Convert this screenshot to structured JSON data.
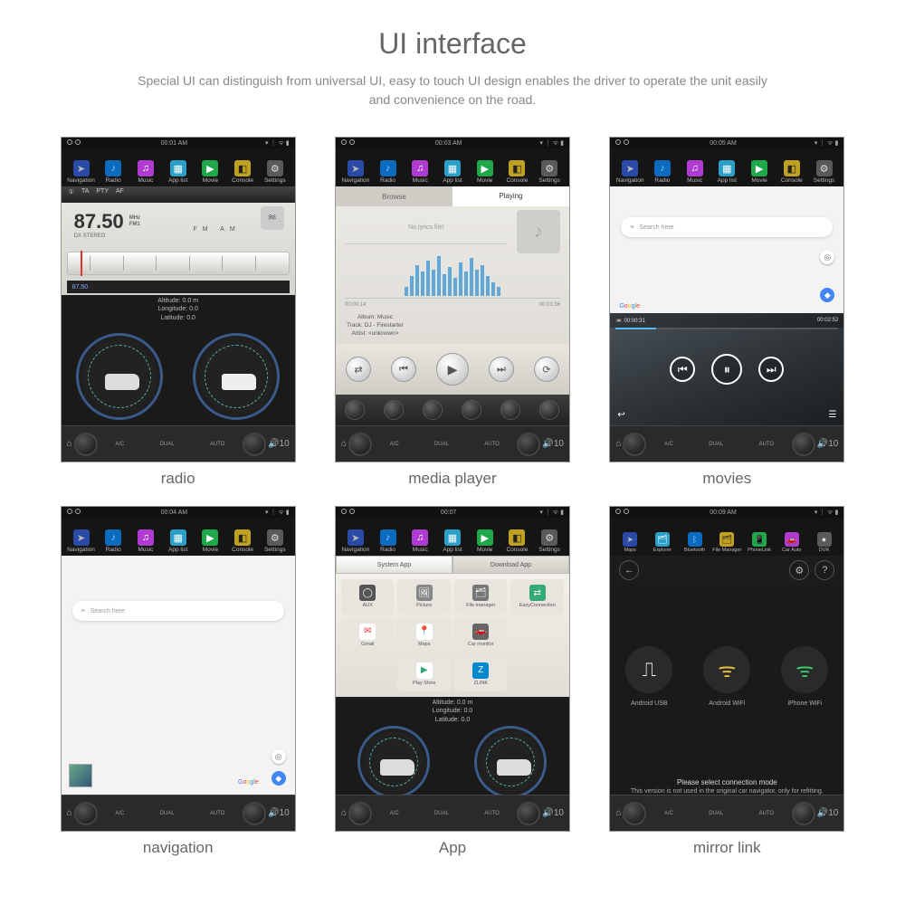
{
  "page": {
    "title": "UI interface",
    "subtitle": "Special UI can distinguish from universal UI, easy to touch UI design enables the driver to operate the unit easily and convenience on the road."
  },
  "captions": [
    "radio",
    "media player",
    "movies",
    "navigation",
    "App",
    "mirror link"
  ],
  "appbar": {
    "items": [
      "Navigation",
      "Radio",
      "Music",
      "App list",
      "Movie",
      "Console",
      "Settings"
    ],
    "items7": [
      "Maps",
      "Explorer",
      "Bluetooth",
      "File Manager",
      "PhoneLink",
      "Car Auto",
      "DVR"
    ]
  },
  "status": {
    "radio": "00:01 AM",
    "media": "00:03 AM",
    "movies": "00:05 AM",
    "nav": "00:04 AM",
    "app": "00:07",
    "mirror": "00:09 AM"
  },
  "radio": {
    "buttons": [
      "TA",
      "PTY",
      "AF"
    ],
    "ind": "①",
    "freq": "87.50",
    "unit": "MHz",
    "band": "FM1",
    "stereo": "DX  STEREO",
    "bands": "FM     AM",
    "preset": "87.50",
    "gps": {
      "alt": "Altitude:  0.0  m",
      "lon": "Longitude:  0.0",
      "lat": "Latitude:  0.0"
    }
  },
  "media": {
    "tabs": [
      "Browse",
      "Playing"
    ],
    "no_lyrics": "No lyrics file!",
    "t0": "00:00:14",
    "t1": "00:03:36",
    "album_l": "Album:",
    "album": "Music",
    "track_l": "Track:",
    "track": "DJ - Firestarter",
    "artist_l": "Artist:",
    "artist": "<unknown>"
  },
  "movies": {
    "search": "Search here",
    "t0": "00:00:31",
    "t1": "00:02:52"
  },
  "nav": {
    "search": "Search here"
  },
  "apps": {
    "tabs": [
      "System App",
      "Download App"
    ],
    "row1": [
      "AUX",
      "Picture",
      "File manager",
      "EasyConnection",
      "Gmail",
      "Maps"
    ],
    "row2": [
      "Car monitor",
      "",
      "",
      "Play Store",
      "ZLINK",
      ""
    ],
    "gps": {
      "alt": "Altitude:  0.0  m",
      "lon": "Longitude:  0.0",
      "lat": "Latitude:  0.0"
    }
  },
  "mirror": {
    "opts": [
      "Android USB",
      "Android WiFi",
      "iPhone WiFi"
    ],
    "title": "Please select connection mode",
    "note": "This version is not used in the original car navigator, only for refitting."
  },
  "ac": {
    "vol": "10"
  }
}
